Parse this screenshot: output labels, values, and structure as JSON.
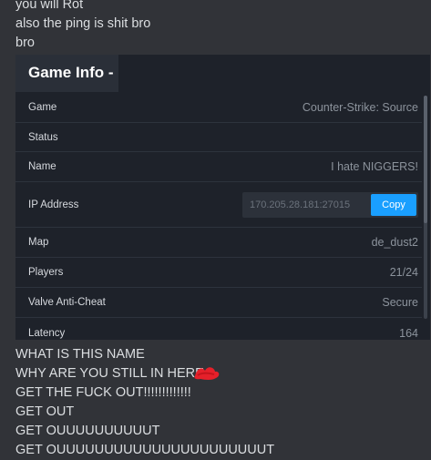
{
  "messages_top": [
    "you will Rot",
    "also the ping is shit bro",
    "bro"
  ],
  "game_info": {
    "title": "Game Info -",
    "rows": [
      {
        "label": "Game",
        "value": "Counter-Strike: Source"
      },
      {
        "label": "Status",
        "value": ""
      },
      {
        "label": "Name",
        "value": "I hate NIGGERS!"
      },
      {
        "label": "IP Address",
        "value": "170.205.28.181:27015"
      },
      {
        "label": "Map",
        "value": "de_dust2"
      },
      {
        "label": "Players",
        "value": "21/24"
      },
      {
        "label": "Valve Anti-Cheat",
        "value": "Secure"
      },
      {
        "label": "Latency",
        "value": "164"
      }
    ],
    "copy_label": "Copy"
  },
  "messages_bottom": [
    "WHAT IS THIS NAME",
    "WHY ARE YOU STILL IN HERE",
    "GET THE FUCK OUT!!!!!!!!!!!!!",
    "GET OUT",
    "GET OUUUUUUUUUUT",
    "GET OUUUUUUUUUUUUUUUUUUUUUUT"
  ],
  "colors": {
    "accent": "#1a9fff",
    "background": "#313338",
    "card": "#1e222a",
    "redaction": "#e5202a"
  }
}
